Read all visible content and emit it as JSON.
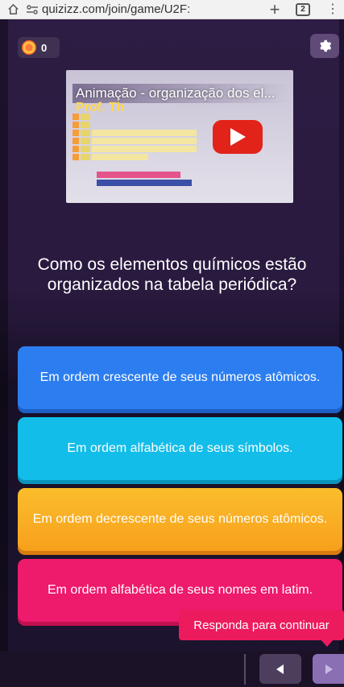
{
  "browser": {
    "url": "quizizz.com/join/game/U2F:",
    "tab_count": "2"
  },
  "game": {
    "score": "0"
  },
  "video": {
    "title": "Animação - organização dos el...",
    "subtitle": "Prof. Thai"
  },
  "question": {
    "text": "Como os elementos químicos estão organizados na tabela periódica?"
  },
  "options": [
    {
      "label": "Em ordem crescente de seus números atômicos."
    },
    {
      "label": "Em ordem alfabética de seus símbolos."
    },
    {
      "label": "Em ordem decrescente de seus números atômicos."
    },
    {
      "label": "Em ordem alfabética de seus nomes em latim."
    }
  ],
  "tooltip": {
    "text": "Responda para continuar"
  },
  "colors": {
    "option_blue": "#2c7ef0",
    "option_cyan": "#13bde9",
    "option_orange": "#f7a01c",
    "option_pink": "#ee1a6c",
    "play_red": "#e2231a"
  }
}
